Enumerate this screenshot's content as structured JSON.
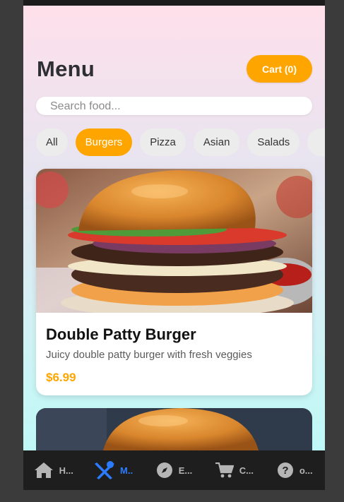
{
  "header": {
    "title": "Menu",
    "cart_label": "Cart (0)"
  },
  "search": {
    "placeholder": "Search food..."
  },
  "categories": {
    "items": [
      "All",
      "Burgers",
      "Pizza",
      "Asian",
      "Salads"
    ],
    "selected": "Burgers"
  },
  "menu_items": [
    {
      "name": "Double Patty Burger",
      "description": "Juicy double patty burger with fresh veggies",
      "price": "$6.99"
    }
  ],
  "bottom_nav": {
    "items": [
      {
        "label": "H...",
        "icon": "home-icon"
      },
      {
        "label": "M..",
        "icon": "utensils-icon"
      },
      {
        "label": "E...",
        "icon": "compass-icon"
      },
      {
        "label": "C...",
        "icon": "cart-icon"
      },
      {
        "label": "o...",
        "icon": "help-icon"
      }
    ],
    "active_index": 1
  },
  "colors": {
    "accent": "#ffa500",
    "nav_active": "#2b7bff",
    "nav_background": "#1e1e1e"
  }
}
